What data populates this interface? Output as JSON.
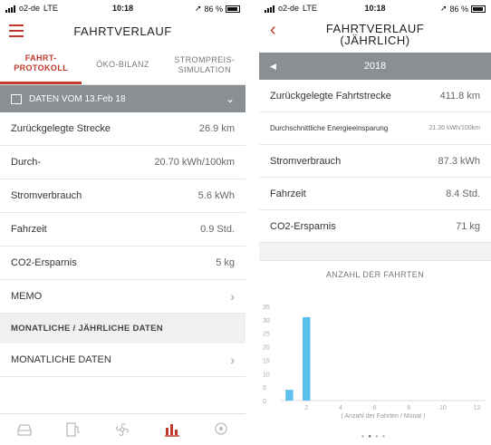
{
  "left": {
    "status": {
      "carrier": "o2-de",
      "network": "LTE",
      "time": "10:18",
      "battery": "86 %"
    },
    "header": {
      "title": "FAHRTVERLAUF"
    },
    "tabs": [
      {
        "label": "FAHRT-\nPROTOKOLL",
        "active": true
      },
      {
        "label": "ÖKO-BILANZ",
        "active": false
      },
      {
        "label": "STROMPREIS-\nSIMULATION",
        "active": false
      }
    ],
    "date_label": "DATEN VOM 13.Feb 18",
    "rows": [
      {
        "label": "Zurückgelegte Strecke",
        "value": "26.9 km"
      },
      {
        "label": "Durch-",
        "value": "20.70 kWh/100km"
      },
      {
        "label": "Stromverbrauch",
        "value": "5.6 kWh"
      },
      {
        "label": "Fahrzeit",
        "value": "0.9 Std."
      },
      {
        "label": "CO2-Ersparnis",
        "value": "5 kg"
      }
    ],
    "memo": "MEMO",
    "section_title": "MONATLICHE / JÄHRLICHE DATEN",
    "monthly": "MONATLICHE DATEN",
    "tabbar_icons": [
      "car-icon",
      "charger-icon",
      "fan-icon",
      "bar-chart-icon",
      "location-icon"
    ]
  },
  "right": {
    "status": {
      "carrier": "o2-de",
      "network": "LTE",
      "time": "10:18",
      "battery": "86 %"
    },
    "header": {
      "title_line1": "FAHRTVERLAUF",
      "title_line2": "(JÄHRLICH)"
    },
    "year": "2018",
    "rows": [
      {
        "label": "Zurückgelegte Fahrtstrecke",
        "value": "411.8 km"
      },
      {
        "label": "Durchschnittliche Energieeinsparung",
        "value": "21.30 kWh/100km"
      },
      {
        "label": "Stromverbrauch",
        "value": "87.3 kWh"
      },
      {
        "label": "Fahrzeit",
        "value": "8.4 Std."
      },
      {
        "label": "CO2-Ersparnis",
        "value": "71 kg"
      }
    ],
    "chart_title": "ANZAHL DER FAHRTEN"
  },
  "chart_data": {
    "type": "bar",
    "title": "ANZAHL DER FAHRTEN",
    "xlabel": "( Anzahl der Fahrten / Monat )",
    "ylabel": "",
    "x": [
      1,
      2
    ],
    "values": [
      4,
      31
    ],
    "x_ticks": [
      2,
      4,
      6,
      8,
      10,
      12
    ],
    "y_ticks": [
      0,
      5,
      10,
      15,
      20,
      25,
      30,
      35
    ],
    "xlim": [
      0.5,
      12.5
    ],
    "ylim": [
      0,
      35
    ],
    "color": "#5bc0eb"
  },
  "colors": {
    "accent": "#c0392b",
    "bar_gray": "#8a8f93",
    "bar_blue": "#5bc0eb"
  }
}
